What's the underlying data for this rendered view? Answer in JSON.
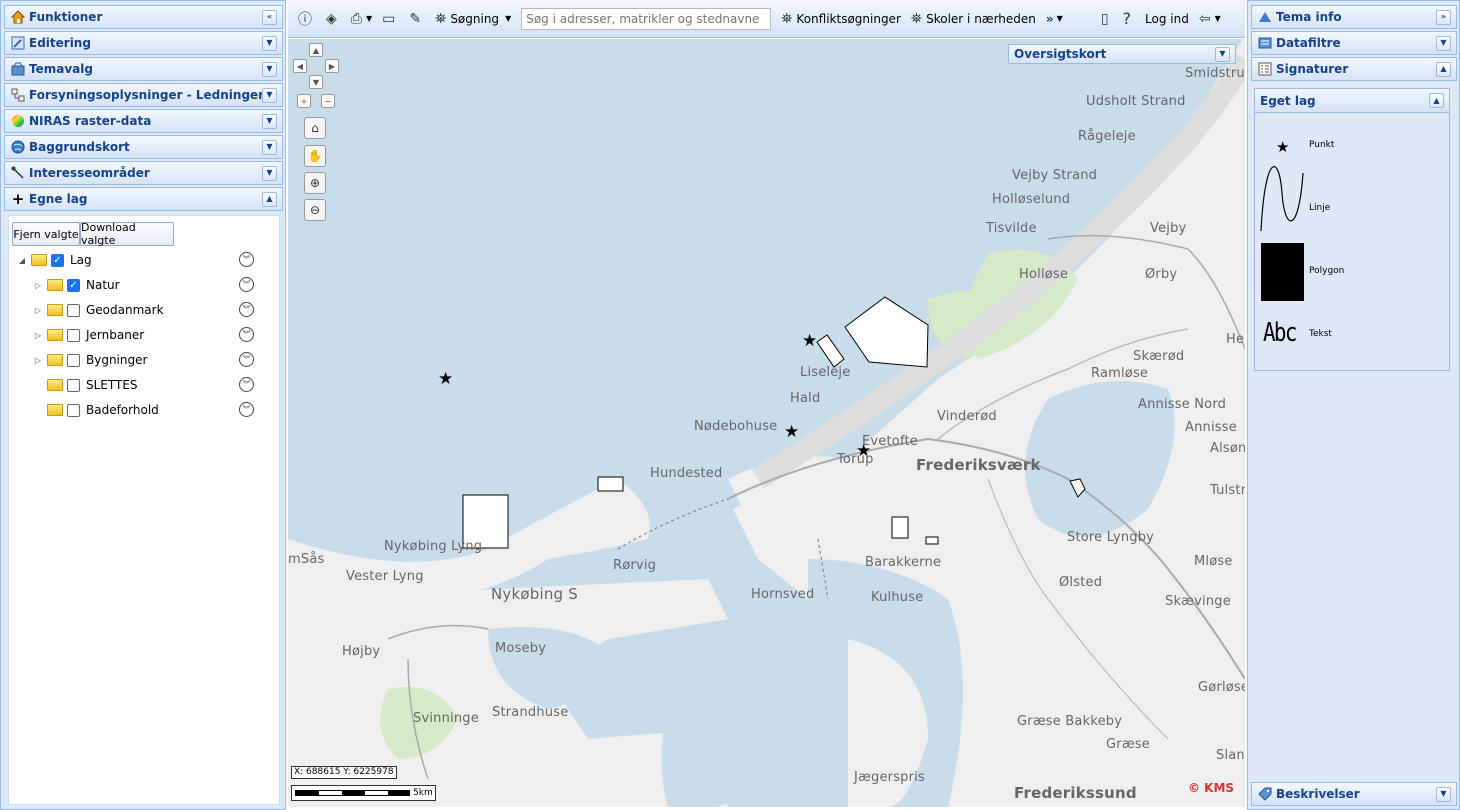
{
  "left_panel": {
    "headers": [
      {
        "label": "Funktioner",
        "icon": "house-icon",
        "collapse": "double-left"
      },
      {
        "label": "Editering",
        "icon": "edit-icon",
        "collapse": "down"
      },
      {
        "label": "Temavalg",
        "icon": "theme-icon",
        "collapse": "down"
      },
      {
        "label": "Forsyningsoplysninger - Ledninger",
        "icon": "network-icon",
        "collapse": "down"
      },
      {
        "label": "NIRAS raster-data",
        "icon": "color-wheel-icon",
        "collapse": "down"
      },
      {
        "label": "Baggrundskort",
        "icon": "globe-icon",
        "collapse": "down"
      },
      {
        "label": "Interesseområder",
        "icon": "pin-line-icon",
        "collapse": "down"
      },
      {
        "label": "Egne lag",
        "icon": "plus-icon",
        "collapse": "up"
      }
    ],
    "buttons": {
      "remove": "Fjern valgte",
      "download": "Download valgte"
    },
    "tree": [
      {
        "label": "Lag",
        "checked": true,
        "level": 0,
        "expander": "open"
      },
      {
        "label": "Natur",
        "checked": true,
        "level": 1,
        "expander": "closed"
      },
      {
        "label": "Geodanmark",
        "checked": false,
        "level": 1,
        "expander": "closed"
      },
      {
        "label": "Jernbaner",
        "checked": false,
        "level": 1,
        "expander": "closed"
      },
      {
        "label": "Bygninger",
        "checked": false,
        "level": 1,
        "expander": "closed"
      },
      {
        "label": "SLETTES",
        "checked": false,
        "level": 1,
        "expander": "none"
      },
      {
        "label": "Badeforhold",
        "checked": false,
        "level": 1,
        "expander": "none"
      }
    ]
  },
  "toolbar": {
    "search_label": "Søgning",
    "search_placeholder": "Søg i adresser, matrikler og stednavne",
    "conflict": "Konfliktsøgninger",
    "schools": "Skoler i nærheden",
    "more": "»",
    "help": "?",
    "login": "Log ind"
  },
  "map": {
    "overview_label": "Oversigtskort",
    "coords": "X: 688615 Y: 6225978",
    "scale_label": "5km",
    "copyright": "© KMS",
    "places": [
      {
        "name": "Smidstru",
        "big": false
      },
      {
        "name": "Udsholt Strand",
        "big": false
      },
      {
        "name": "Rågeleje",
        "big": false
      },
      {
        "name": "Vejby Strand",
        "big": false
      },
      {
        "name": "Holløselund",
        "big": false
      },
      {
        "name": "Tisvilde",
        "big": false
      },
      {
        "name": "Vejby",
        "big": false
      },
      {
        "name": "Holløse",
        "big": false
      },
      {
        "name": "Ørby",
        "big": false
      },
      {
        "name": "He",
        "big": false
      },
      {
        "name": "Skærød",
        "big": false
      },
      {
        "name": "Liseleje",
        "big": false
      },
      {
        "name": "Ramløse",
        "big": false
      },
      {
        "name": "Hald",
        "big": false
      },
      {
        "name": "Annisse Nord",
        "big": false
      },
      {
        "name": "Vinderød",
        "big": false
      },
      {
        "name": "Annisse",
        "big": false
      },
      {
        "name": "Nødebohuse",
        "big": false
      },
      {
        "name": "Evetofte",
        "big": false
      },
      {
        "name": "Alsøn",
        "big": false
      },
      {
        "name": "Torup",
        "big": false
      },
      {
        "name": "Frederiksværk",
        "big": true
      },
      {
        "name": "Hundested",
        "big": false
      },
      {
        "name": "Tulstr",
        "big": false
      },
      {
        "name": "Store Lyngby",
        "big": false
      },
      {
        "name": "Nykøbing Lyng",
        "big": false
      },
      {
        "name": "Mløse",
        "big": false
      },
      {
        "name": "mSås",
        "big": false
      },
      {
        "name": "Barakkerne",
        "big": false
      },
      {
        "name": "Rørvig",
        "big": false
      },
      {
        "name": "Vester Lyng",
        "big": false
      },
      {
        "name": "Ølsted",
        "big": false
      },
      {
        "name": "Nykøbing S",
        "big": false
      },
      {
        "name": "Hornsved",
        "big": false
      },
      {
        "name": "Kulhuse",
        "big": false
      },
      {
        "name": "Skævinge",
        "big": false
      },
      {
        "name": "Moseby",
        "big": false
      },
      {
        "name": "Højby",
        "big": false
      },
      {
        "name": "Gørløse",
        "big": false
      },
      {
        "name": "Strandhuse",
        "big": false
      },
      {
        "name": "Svinninge",
        "big": false
      },
      {
        "name": "Græse Bakkeby",
        "big": false
      },
      {
        "name": "Græse",
        "big": false
      },
      {
        "name": "Slan",
        "big": false
      },
      {
        "name": "Jægerspris",
        "big": false
      },
      {
        "name": "Frederikssund",
        "big": true
      }
    ]
  },
  "right_panel": {
    "headers": [
      {
        "label": "Tema info",
        "icon": "triangle-icon",
        "collapse": "double-right"
      },
      {
        "label": "Datafiltre",
        "icon": "filter-icon",
        "collapse": "down"
      },
      {
        "label": "Signaturer",
        "icon": "legend-icon",
        "collapse": "up"
      }
    ],
    "eget_lag": "Eget lag",
    "legend": [
      {
        "label": "Punkt",
        "symbol": "star"
      },
      {
        "label": "Linje",
        "symbol": "wave"
      },
      {
        "label": "Polygon",
        "symbol": "square"
      },
      {
        "label": "Tekst",
        "symbol": "text",
        "sample": "Abc"
      }
    ],
    "footer": "Beskrivelser"
  }
}
